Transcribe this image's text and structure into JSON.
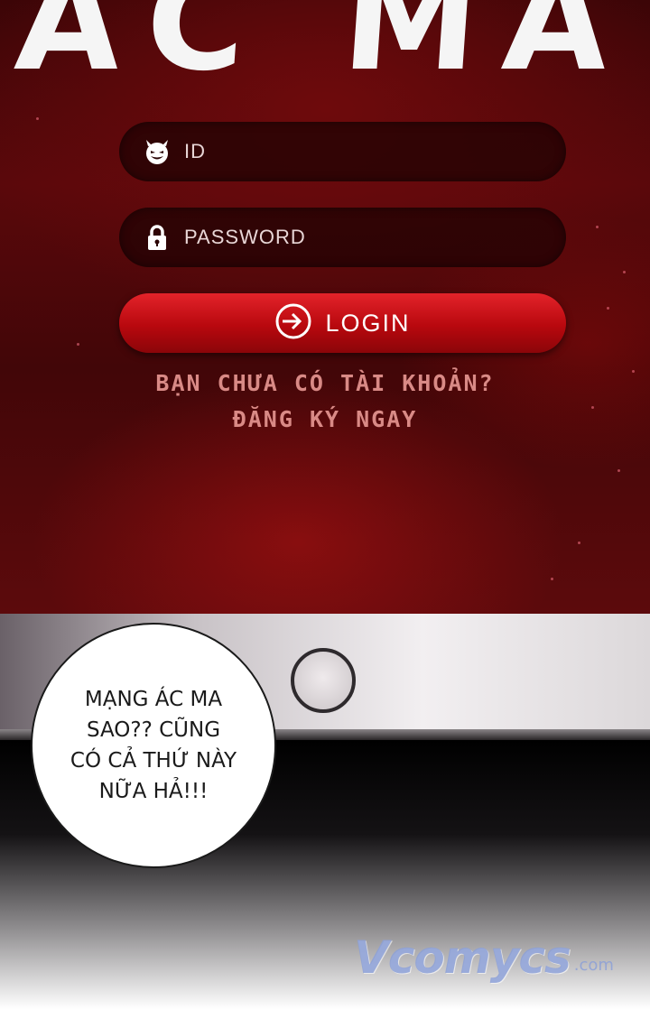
{
  "app_title_fragment": "ÁC MA",
  "login_form": {
    "id_placeholder": "ID",
    "id_icon": "devil-face-icon",
    "password_placeholder": "PASSWORD",
    "password_icon": "lock-icon",
    "login_label": "LOGIN",
    "login_icon": "login-arrow-icon",
    "signup_question": "BẠN CHƯA CÓ TÀI KHOẢN?",
    "signup_link": "ĐĂNG KÝ NGAY"
  },
  "speech_bubble": {
    "lines": [
      "MẠNG ÁC MA",
      "SAO?? CŨNG",
      "CÓ CẢ THỨ NÀY",
      "NỮA HẢ!!!"
    ]
  },
  "watermark": {
    "text": "Vcomycs",
    "domain": ".com"
  },
  "colors": {
    "screen_background": "#4a0709",
    "login_button": "#c8141b",
    "field_background": "#230304",
    "signup_text": "#d98a86"
  }
}
